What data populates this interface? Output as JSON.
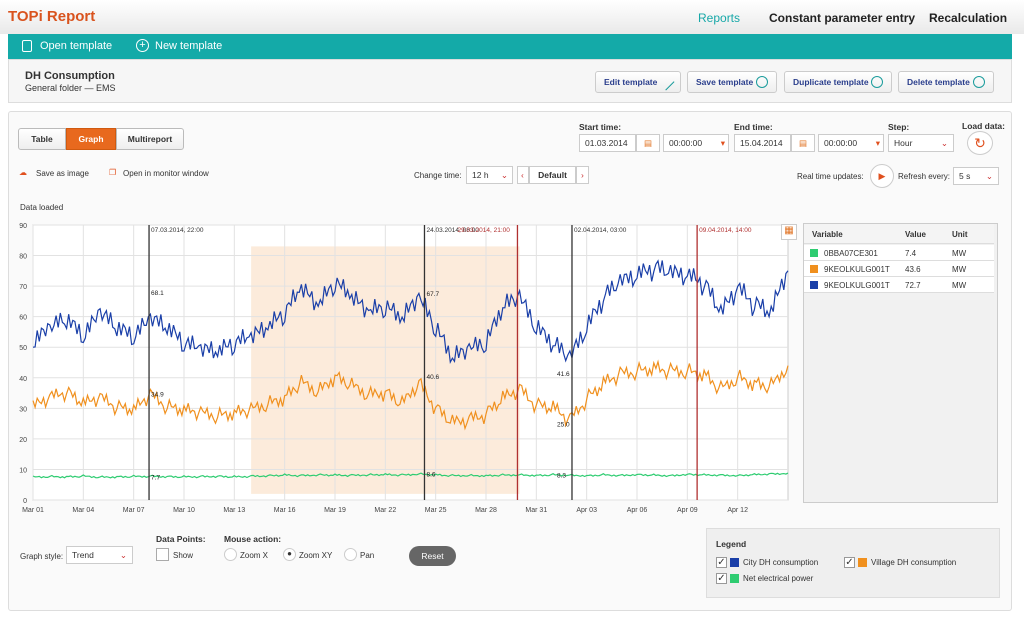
{
  "app": {
    "title": "TOPi Report"
  },
  "nav": {
    "reports": "Reports",
    "constant": "Constant parameter entry",
    "recalc": "Recalculation"
  },
  "toolbar": {
    "open": "Open template",
    "new": "New template"
  },
  "template": {
    "name": "DH Consumption",
    "folder": "General folder — EMS",
    "edit": "Edit template",
    "save": "Save template",
    "duplicate": "Duplicate template",
    "delete": "Delete template"
  },
  "views": {
    "table": "Table",
    "graph": "Graph",
    "multireport": "Multireport",
    "active": "Graph"
  },
  "time": {
    "start_label": "Start time:",
    "start_date": "01.03.2014",
    "start_time": "00:00:00",
    "end_label": "End time:",
    "end_date": "15.04.2014",
    "end_time": "00:00:00",
    "step_label": "Step:",
    "step": "Hour",
    "load_label": "Load data:"
  },
  "actions": {
    "save_image": "Save as image",
    "open_monitor": "Open in monitor window",
    "change_time": "Change time:",
    "change_value": "12 h",
    "default": "Default",
    "realtime": "Real time updates:",
    "refresh": "Refresh every:",
    "refresh_value": "5 s"
  },
  "status": "Data loaded",
  "values_table": {
    "headers": [
      "Variable",
      "Value",
      "Unit"
    ],
    "rows": [
      {
        "variable": "0BBA07CE301",
        "value": "7.4",
        "unit": "MW",
        "color": "#2ecc71"
      },
      {
        "variable": "9KEOLKULG001T",
        "value": "43.6",
        "unit": "MW",
        "color": "#f0901e"
      },
      {
        "variable": "9KEOLKULG001T",
        "value": "72.7",
        "unit": "MW",
        "color": "#1a3fa8"
      }
    ]
  },
  "controls": {
    "graph_style_label": "Graph style:",
    "graph_style": "Trend",
    "data_points_label": "Data Points:",
    "show": "Show",
    "show_checked": false,
    "mouse_label": "Mouse action:",
    "zoom_x": "Zoom X",
    "zoom_xy": "Zoom XY",
    "pan": "Pan",
    "mouse_selected": "Zoom XY",
    "reset": "Reset"
  },
  "legend": {
    "title": "Legend",
    "items": [
      {
        "name": "City DH consumption",
        "color": "#1a3fa8",
        "checked": true
      },
      {
        "name": "Village DH consumption",
        "color": "#f0901e",
        "checked": true
      },
      {
        "name": "Net electrical power",
        "color": "#2ecc71",
        "checked": true
      }
    ]
  },
  "chart_data": {
    "type": "line",
    "ylim": [
      0,
      90
    ],
    "yticks": [
      0,
      10,
      20,
      30,
      40,
      50,
      60,
      70,
      80,
      90
    ],
    "grid": true,
    "xticks": [
      "Mar 01",
      "Mar 04",
      "Mar 07",
      "Mar 10",
      "Mar 13",
      "Mar 16",
      "Mar 19",
      "Mar 22",
      "Mar 25",
      "Mar 28",
      "Mar 31",
      "Apr 03",
      "Apr 06",
      "Apr 09",
      "Apr 12"
    ],
    "xlim": [
      "2014-03-01",
      "2014-04-15"
    ],
    "selection": {
      "from": "2014-03-14",
      "to": "2014-03-30",
      "ymin": 2,
      "ymax": 83
    },
    "series": [
      {
        "name": "City DH consumption",
        "color": "#1a3fa8",
        "values": [
          50,
          55,
          58,
          52,
          60,
          55,
          52,
          58,
          55,
          50,
          48,
          47,
          50,
          52,
          55,
          60,
          68,
          62,
          70,
          65,
          60,
          62,
          58,
          65,
          55,
          45,
          48,
          50,
          62,
          65,
          55,
          50,
          45,
          55,
          65,
          70,
          72,
          75,
          73,
          72,
          70,
          60,
          68,
          63,
          60,
          75
        ]
      },
      {
        "name": "Village DH consumption",
        "color": "#f0901e",
        "values": [
          30,
          33,
          35,
          31,
          33,
          30,
          29,
          34,
          30,
          29,
          28,
          27,
          28,
          29,
          31,
          33,
          38,
          35,
          40,
          37,
          34,
          35,
          31,
          38,
          30,
          25,
          26,
          28,
          33,
          36,
          31,
          30,
          26,
          33,
          38,
          41,
          42,
          43,
          42,
          42,
          41,
          36,
          40,
          38,
          37,
          44
        ]
      },
      {
        "name": "Net electrical power",
        "color": "#2ecc71",
        "values": [
          7.5,
          7.7,
          7.6,
          7.8,
          7.5,
          7.6,
          7.7,
          7.8,
          7.7,
          7.6,
          7.7,
          7.8,
          7.6,
          7.8,
          8.0,
          8.2,
          8.0,
          8.3,
          8.2,
          8.1,
          8.3,
          8.4,
          8.2,
          8.6,
          8.3,
          8.0,
          8.1,
          8.0,
          8.2,
          8.3,
          8.1,
          8.3,
          8.2,
          8.0,
          8.3,
          8.1,
          8.4,
          8.2,
          8.0,
          8.5,
          8.3,
          8.2,
          8.1,
          8.4,
          8.6,
          8.8
        ]
      }
    ],
    "markers": [
      {
        "label": "07.03.2014, 22:00",
        "date": "2014-03-07T22:00",
        "color": "#333",
        "values": [
          "68.1",
          "34.9",
          "7.7"
        ]
      },
      {
        "label": "24.03.2014, 08:00",
        "date": "2014-03-24T08:00",
        "color": "#333",
        "values": [
          "67.7",
          "40.6",
          "8.6"
        ]
      },
      {
        "label": "29.03.2014, 21:00",
        "date": "2014-03-29T21:00",
        "color": "#b03030",
        "values": []
      },
      {
        "label": "02.04.2014, 03:00",
        "date": "2014-04-02T03:00",
        "color": "#333",
        "values": [
          "41.6",
          "25.0",
          "8.3"
        ]
      },
      {
        "label": "09.04.2014, 14:00",
        "date": "2014-04-09T14:00",
        "color": "#b03030",
        "values": []
      }
    ]
  }
}
